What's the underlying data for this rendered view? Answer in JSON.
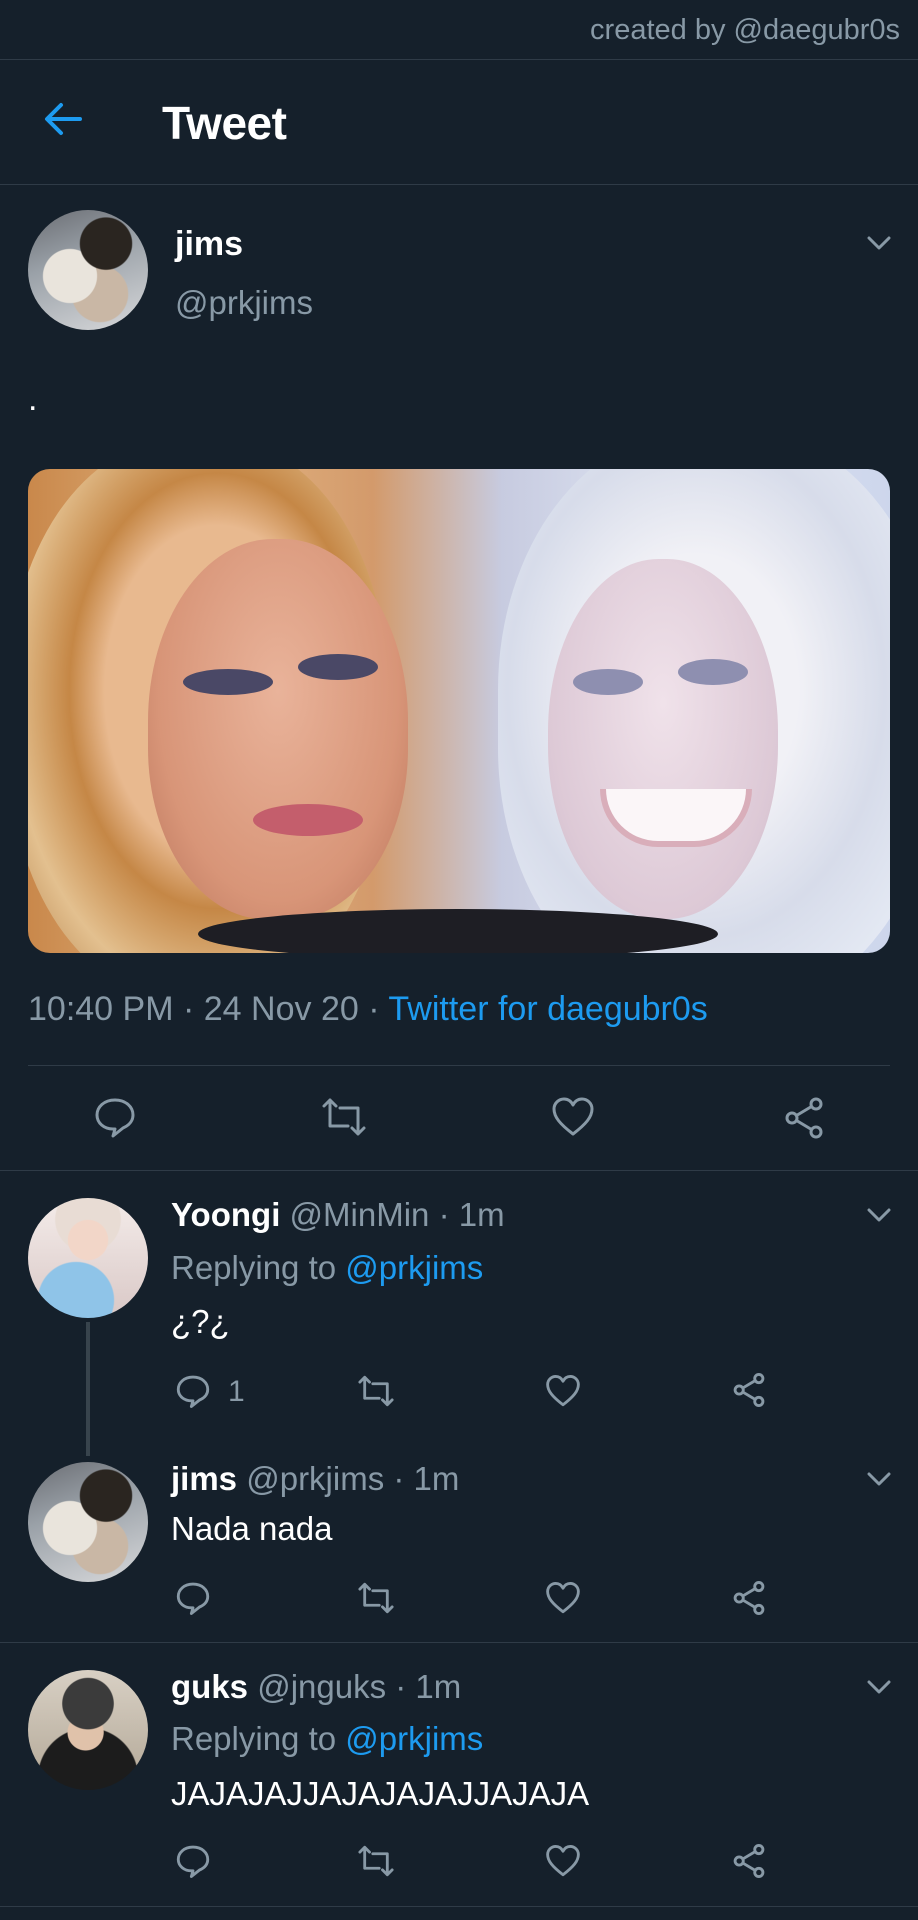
{
  "credit": "created by @daegubr0s",
  "header": {
    "title": "Tweet"
  },
  "main_tweet": {
    "name": "jims",
    "handle": "@prkjims",
    "text": ".",
    "time": "10:40 PM",
    "date": "24 Nov 20",
    "source": "Twitter for daegubr0s"
  },
  "replies": [
    {
      "name": "Yoongi",
      "handle": "@MinMin",
      "time": "1m",
      "replying_label": "Replying to",
      "replying_to": "@prkjims",
      "text": "¿?¿",
      "reply_count": "1"
    },
    {
      "name": "jims",
      "handle": "@prkjims",
      "time": "1m",
      "text": "Nada nada"
    },
    {
      "name": "guks",
      "handle": "@jnguks",
      "time": "1m",
      "replying_label": "Replying to",
      "replying_to": "@prkjims",
      "text": "JAJAJAJJAJAJAJAJJAJAJA"
    }
  ],
  "colors": {
    "background": "#15202b",
    "accent": "#1d9bf0",
    "muted": "#8899a6",
    "divider": "#2f3b47"
  }
}
